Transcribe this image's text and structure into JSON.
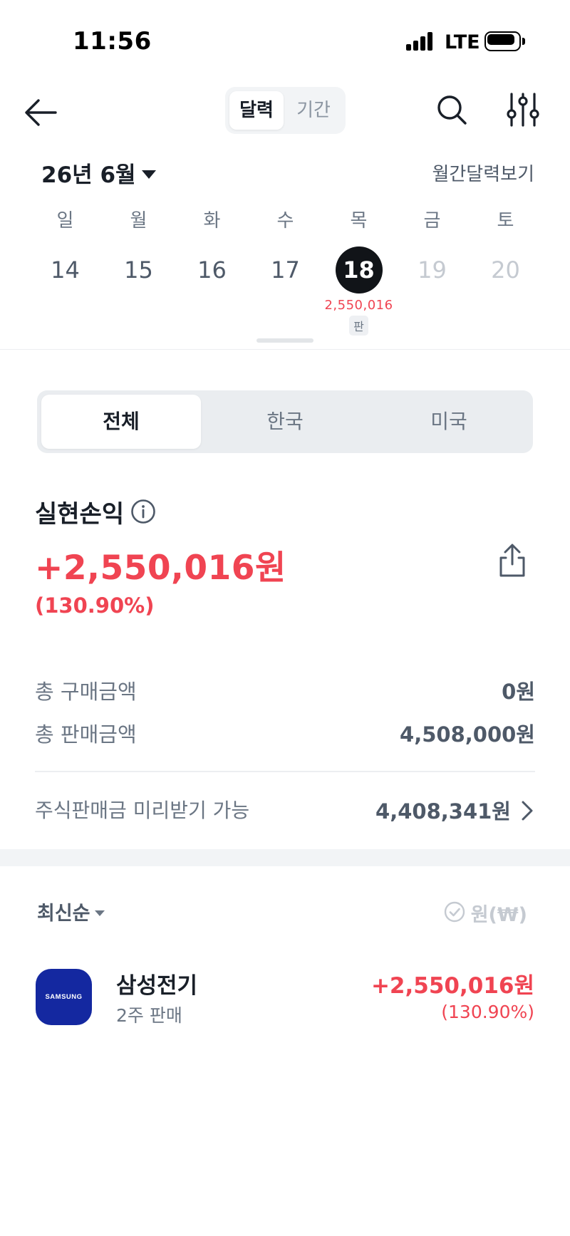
{
  "status_bar": {
    "time": "11:56",
    "network": "LTE",
    "icons": [
      "signal-icon",
      "battery-icon"
    ]
  },
  "nav": {
    "icons": [
      "back-arrow-icon",
      "search-icon",
      "filter-sliders-icon"
    ],
    "segments": [
      {
        "label": "달력",
        "active": true
      },
      {
        "label": "기간",
        "active": false
      }
    ]
  },
  "calendar": {
    "month_label": "26년 6월",
    "monthly_view_label": "월간달력보기",
    "days": [
      {
        "dow": "일",
        "date": "14",
        "state": "past"
      },
      {
        "dow": "월",
        "date": "15",
        "state": "past"
      },
      {
        "dow": "화",
        "date": "16",
        "state": "past"
      },
      {
        "dow": "수",
        "date": "17",
        "state": "past"
      },
      {
        "dow": "목",
        "date": "18",
        "state": "selected",
        "amount": "2,550,016",
        "badge": "판"
      },
      {
        "dow": "금",
        "date": "19",
        "state": "future"
      },
      {
        "dow": "토",
        "date": "20",
        "state": "future"
      }
    ]
  },
  "market_tabs": [
    {
      "label": "전체",
      "active": true
    },
    {
      "label": "한국",
      "active": false
    },
    {
      "label": "미국",
      "active": false
    }
  ],
  "summary": {
    "title": "실현손익",
    "amount": "+2,550,016원",
    "rate": "(130.90%)",
    "rows": [
      {
        "label": "총 구매금액",
        "value": "0원"
      },
      {
        "label": "총 판매금액",
        "value": "4,508,000원"
      }
    ],
    "prepay_label": "주식판매금 미리받기 가능",
    "prepay_value": "4,408,341원"
  },
  "list": {
    "sort_label": "최신순",
    "currency_label": "원(₩)",
    "items": [
      {
        "logo_text": "SAMSUNG",
        "name": "삼성전기",
        "sub": "2주 판매",
        "amount": "+2,550,016원",
        "rate": "(130.90%)"
      }
    ]
  },
  "colors": {
    "accent_red": "#f04452",
    "text_primary": "#191f28",
    "text_secondary": "#6b7684",
    "samsung_blue": "#1428a0",
    "selected_date_bg": "#111418"
  }
}
